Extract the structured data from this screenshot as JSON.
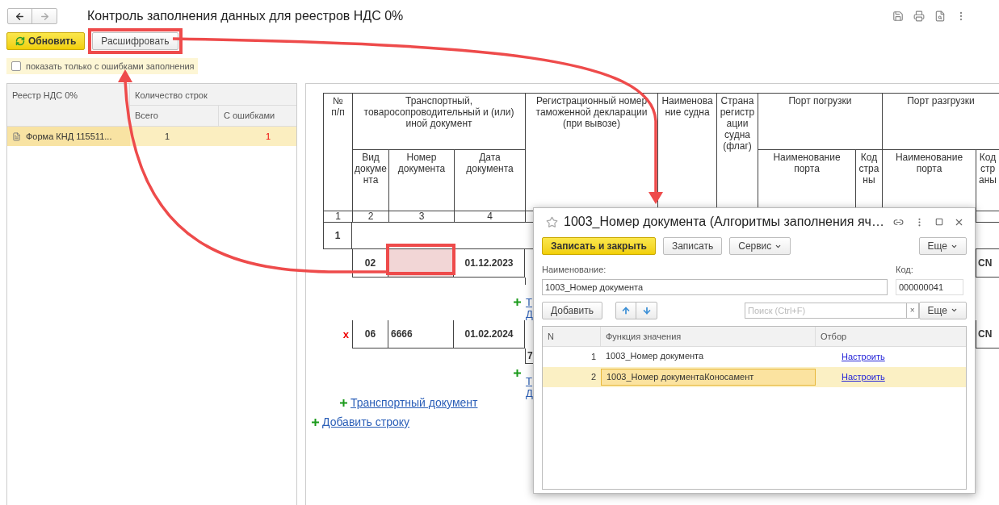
{
  "title": "Контроль заполнения данных для реестров НДС 0%",
  "toolbar": [
    {
      "label": "Обновить",
      "kind": "primary"
    },
    {
      "label": "Расшифровать",
      "kind": "default"
    }
  ],
  "filter": {
    "label": "показать только с ошибками заполнения",
    "checked": false
  },
  "registers": {
    "columns": {
      "register": "Реестр НДС 0%",
      "count_group": "Количество строк",
      "total": "Всего",
      "errors": "С ошибками"
    },
    "rows": [
      {
        "name": "Форма КНД 115511...",
        "total": "1",
        "errors": "1",
        "selected": true
      }
    ]
  },
  "sheet": {
    "header": {
      "no": "№ п/п",
      "transport": "Транспортный, товаросопроводительный и (или) иной документ",
      "doc_type": "Вид документа",
      "doc_number": "Номер документа",
      "doc_date": "Дата документа",
      "declaration": "Регистрационный номер таможенной декларации (при вывозе)",
      "vessel": "Наименование судна",
      "flag": "Страна регистрации судна (флаг)",
      "loading_port": "Порт погрузки",
      "unloading_port": "Порт разгрузки",
      "loading_port_name": "Наименование порта",
      "loading_country": "Код страны",
      "unloading_port_name": "Наименование порта",
      "unloading_country": "Код страны"
    },
    "column_numbers": [
      "1",
      "2",
      "3",
      "4"
    ],
    "rows": [
      {
        "number": "1",
        "documents": [
          {
            "type": "02",
            "date": "01.12.2023",
            "number_error": true,
            "country": "CN",
            "links": [
              "Т",
              "Д"
            ]
          },
          {
            "type": "06",
            "number": "6666",
            "date": "01.02.2024",
            "number_error": false,
            "mark": "x",
            "country": "CN",
            "sub_value": "7",
            "links": [
              "Т",
              "Д"
            ]
          }
        ]
      }
    ],
    "add_document": "Транспортный документ",
    "add_row": "Добавить строку"
  },
  "dialog": {
    "title": "1003_Номер документа (Алгоритмы заполнения яч…",
    "buttons": [
      {
        "label": "Записать и закрыть",
        "kind": "primary"
      },
      {
        "label": "Записать",
        "kind": "default"
      },
      {
        "label": "Сервис",
        "kind": "menu"
      }
    ],
    "more": "Еще",
    "name_label": "Наименование:",
    "name_value": "1003_Номер документа",
    "code_label": "Код:",
    "code_value": "000000041",
    "add": "Добавить",
    "search_placeholder": "Поиск (Ctrl+F)",
    "clear": "×",
    "list_more": "Еще",
    "table": {
      "columns": [
        "N",
        "Функция значения",
        "Отбор"
      ],
      "rows": [
        {
          "n": "1",
          "function": "1003_Номер документа",
          "filter": "Настроить",
          "selected": false
        },
        {
          "n": "2",
          "function": "1003_Номер документаКоносамент",
          "filter": "Настроить",
          "selected": true
        }
      ]
    }
  }
}
